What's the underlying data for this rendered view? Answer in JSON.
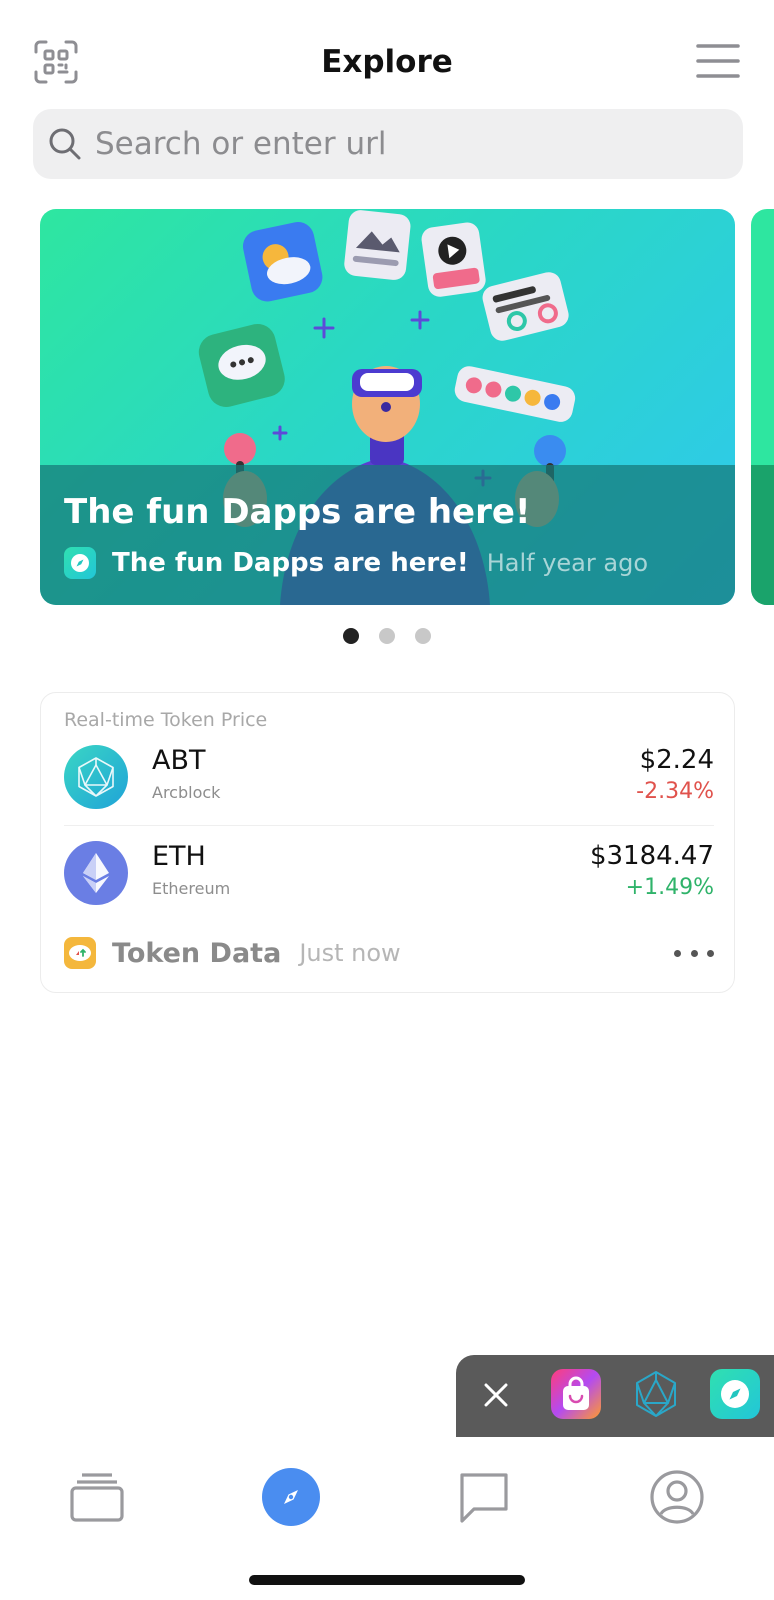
{
  "header": {
    "title": "Explore",
    "scan_icon": "qr-scan-icon",
    "menu_icon": "hamburger-menu-icon"
  },
  "search": {
    "placeholder": "Search or enter url",
    "icon": "search-icon"
  },
  "banner": {
    "title": "The fun Dapps are here!",
    "source_name": "The fun Dapps are here!",
    "time": "Half year ago",
    "pagination": {
      "count": 3,
      "active_index": 0
    }
  },
  "token_card": {
    "label": "Real-time Token Price",
    "tokens": [
      {
        "symbol": "ABT",
        "name": "Arcblock",
        "price": "$2.24",
        "change": "-2.34%",
        "trend": "down",
        "icon": "arcblock-logo-icon"
      },
      {
        "symbol": "ETH",
        "name": "Ethereum",
        "price": "$3184.47",
        "change": "+1.49%",
        "trend": "up",
        "icon": "ethereum-logo-icon"
      }
    ],
    "footer": {
      "source_name": "Token Data",
      "time": "Just now",
      "more_icon": "more-dots-icon"
    }
  },
  "dock": {
    "close_icon": "close-icon",
    "apps": [
      {
        "name": "shopping-bag-app-icon"
      },
      {
        "name": "arcblock-app-icon"
      },
      {
        "name": "compass-app-icon"
      }
    ]
  },
  "bottom_nav": {
    "items": [
      {
        "name": "wallet-cards-icon",
        "active": false
      },
      {
        "name": "explore-compass-icon",
        "active": true
      },
      {
        "name": "chat-bubble-icon",
        "active": false
      },
      {
        "name": "profile-icon",
        "active": false
      }
    ]
  },
  "colors": {
    "accent": "#4a8df0",
    "negative": "#e0524c",
    "positive": "#2fb36a",
    "search_bg": "#efeff0"
  }
}
